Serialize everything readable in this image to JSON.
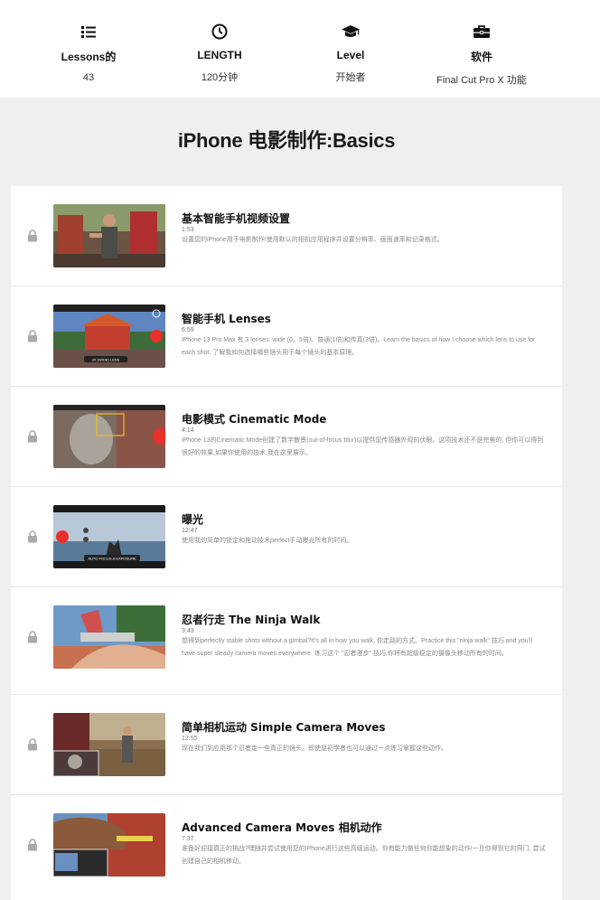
{
  "stats": [
    {
      "icon": "list-icon",
      "label": "Lessons的",
      "value": "43"
    },
    {
      "icon": "clock-icon",
      "label": "LENGTH",
      "value": "120分钟"
    },
    {
      "icon": "graduation-cap-icon",
      "label": "Level",
      "value": "开始者"
    },
    {
      "icon": "toolbox-icon",
      "label": "软件",
      "value": "Final Cut Pro X 功能"
    }
  ],
  "course": {
    "title": "iPhone 电影制作:Basics"
  },
  "lessons": [
    {
      "title": "基本智能手机视频设置",
      "duration": "1:53",
      "description": "设置您的iPhone用于电影制作!使用默认的相机应用程序并设置分辨率、画面速率和记录格式。",
      "thumb_caption": ""
    },
    {
      "title": "智能手机 Lenses",
      "duration": "6:59",
      "description": "iPhone 13 Pro Max 有 3 lenses: wide (0。5倍)、普通(1倍)和传真(3倍)。Learn the basics of how I choose which lens to use for each shot. 了解我如何选择哪些镜头用于每个镜头的基本原理。",
      "thumb_caption": "3X (WIDE) LENS"
    },
    {
      "title": "电影模式 Cinematic Mode",
      "duration": "4:14",
      "description": "iPhone 13的Cinematic Mode创建了数字散景(out-of-focus blur)以提供您传感器外观的伏眼。这项技术还不是完美的, 但你可以得到很好的效果,如果你使用的技术,我在这里展示。",
      "thumb_caption": ""
    },
    {
      "title": "曝光",
      "duration": "12:47",
      "description": "使用我的简单的锁定和拖动技术perfect手动曝光所有的时间。",
      "thumb_caption": "AUTO FOCUS & EXPOSURE"
    },
    {
      "title": "忍者行走 The Ninja Walk",
      "duration": "3:43",
      "description": "想得到perfectly stable shots without a gimbal?It's all in how you walk, 你走路的方式。Practice this \"ninja walk\" 技巧 and you'll have super steady camera moves everywhere. 练习这个 \"忍者漫步\" 技巧,你将有超级稳定的摄像头移动所有的时间。",
      "thumb_caption": ""
    },
    {
      "title": "简单相机运动 Simple Camera Moves",
      "duration": "12:55",
      "description": "现在我们到应用那个忍者走一些真正的镜头。即使是初学者也可以通过一点练习掌握这些动作。",
      "thumb_caption": ""
    },
    {
      "title": "Advanced Camera Moves 相机动作",
      "duration": "7:37",
      "description": "准备好迎接真正的挑战?嘿随并尝试使用您的iPhone进行这些高级运动。你有能力做任何你能想象的动作!一旦你得到它的窍门, 尝试创建自己的相机移动。",
      "thumb_caption": ""
    }
  ]
}
